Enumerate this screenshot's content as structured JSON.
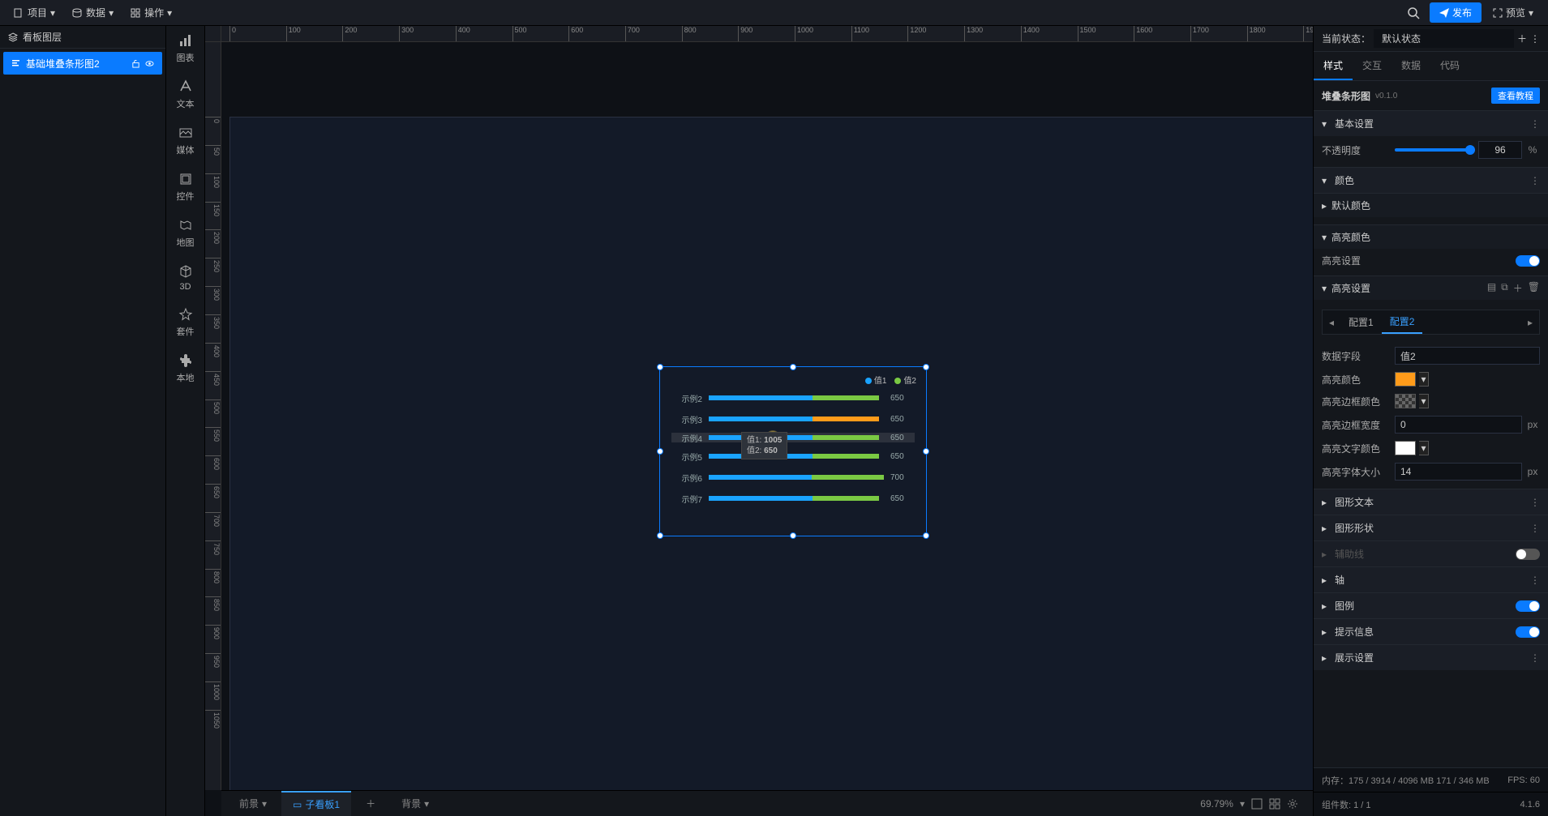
{
  "menu": {
    "project": "项目",
    "data": "数据",
    "ops": "操作"
  },
  "top": {
    "publish": "发布",
    "preview": "预览"
  },
  "layers": {
    "title": "看板图层",
    "item": "基础堆叠条形图2"
  },
  "widgets": [
    {
      "icon": "chart",
      "label": "图表"
    },
    {
      "icon": "text",
      "label": "文本"
    },
    {
      "icon": "media",
      "label": "媒体"
    },
    {
      "icon": "control",
      "label": "控件"
    },
    {
      "icon": "map",
      "label": "地图"
    },
    {
      "icon": "3d",
      "label": "3D"
    },
    {
      "icon": "suite",
      "label": "套件"
    },
    {
      "icon": "local",
      "label": "本地"
    }
  ],
  "chart_data": {
    "type": "bar",
    "orientation": "horizontal",
    "series": [
      {
        "name": "值1",
        "color": "#1aa3ff"
      },
      {
        "name": "值2",
        "color": "#7ac943"
      }
    ],
    "categories": [
      "示例2",
      "示例3",
      "示例4",
      "示例5",
      "示例6",
      "示例7"
    ],
    "values": {
      "示例2": {
        "v1": 1005,
        "v2": 650,
        "label": "650"
      },
      "示例3": {
        "v1": 1005,
        "v2": 650,
        "label": "650",
        "series2_color": "#ff9b1a"
      },
      "示例4": {
        "v1": 1005,
        "v2": 650,
        "label": "650",
        "highlight": true
      },
      "示例5": {
        "v1": 1005,
        "v2": 650,
        "label": "650"
      },
      "示例6": {
        "v1": 1005,
        "v2": 700,
        "label": "700"
      },
      "示例7": {
        "v1": 1005,
        "v2": 650,
        "label": "650"
      }
    },
    "tooltip": {
      "row": "示例5",
      "lines": [
        [
          "值1:",
          "1005"
        ],
        [
          "值2:",
          "650"
        ]
      ]
    }
  },
  "bottom": {
    "front": "前景",
    "subboard": "子看板1",
    "back": "背景",
    "zoom": "69.79%"
  },
  "inspector": {
    "state_label": "当前状态：",
    "state_name": "默认状态",
    "tabs": [
      "样式",
      "交互",
      "数据",
      "代码"
    ],
    "title": "堆叠条形图",
    "version": "v0.1.0",
    "tutorial": "查看教程",
    "basic": {
      "title": "基本设置",
      "opacity_label": "不透明度",
      "opacity": "96",
      "pct": "%"
    },
    "color": {
      "title": "颜色",
      "default": "默认颜色",
      "highlight": "高亮颜色",
      "hl_switch": "高亮设置"
    },
    "hl": {
      "title": "高亮设置",
      "cfg1": "配置1",
      "cfg2": "配置2",
      "field_label": "数据字段",
      "field": "值2",
      "hlcolor": "高亮颜色",
      "hlcolor_val": "#ff9b1a",
      "border": "高亮边框颜色",
      "borderw": "高亮边框宽度",
      "borderw_val": "0",
      "px": "px",
      "textcolor": "高亮文字颜色",
      "textcolor_val": "#ffffff",
      "fontsize": "高亮字体大小",
      "fontsize_val": "14"
    },
    "sections": [
      "图形文本",
      "图形形状",
      "辅助线",
      "轴",
      "图例",
      "提示信息",
      "展示设置"
    ]
  },
  "status": {
    "mem": "内存：175 / 3914 / 4096 MB  171 / 346 MB",
    "fps": "FPS:  60",
    "parts": "组件数: 1 / 1",
    "ver": "4.1.6"
  }
}
